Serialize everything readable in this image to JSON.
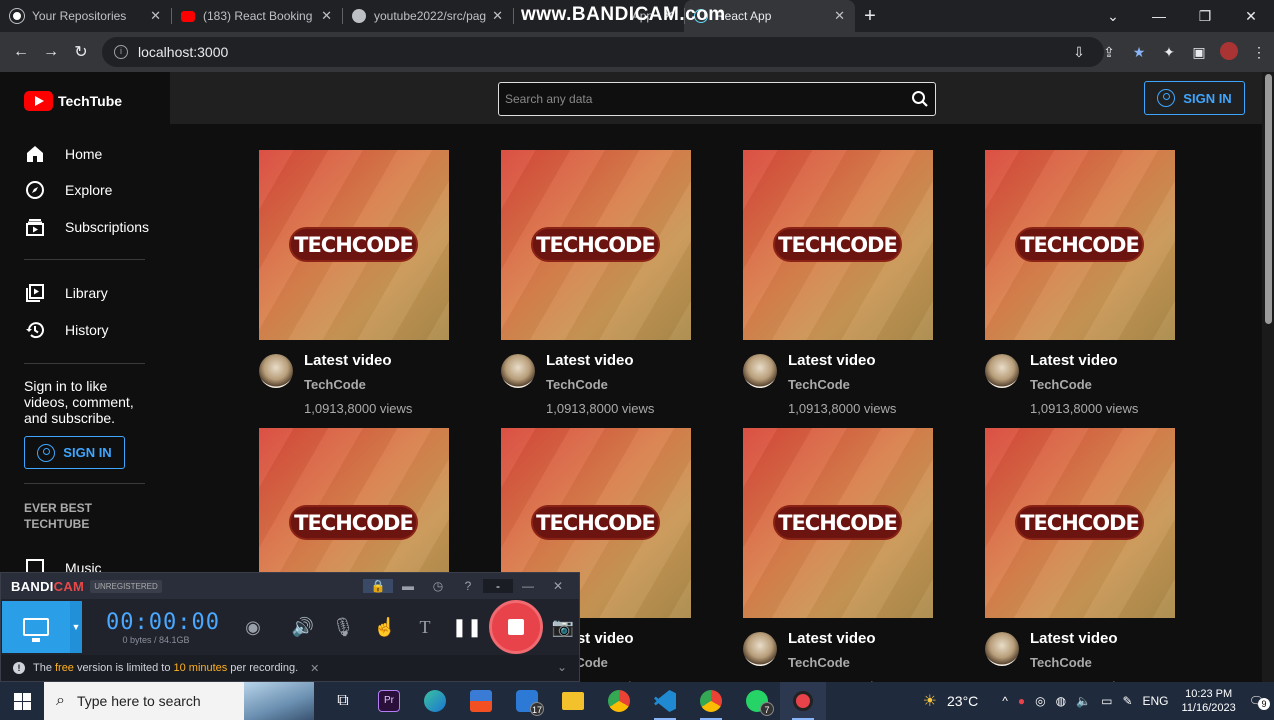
{
  "browser": {
    "tabs": [
      {
        "title": "Your Repositories",
        "favicon": "github-icon",
        "active": false
      },
      {
        "title": "(183) React Booking",
        "favicon": "youtube-icon",
        "active": false
      },
      {
        "title": "youtube2022/src/pag",
        "favicon": "github-icon",
        "active": false
      },
      {
        "title": "App",
        "favicon": "react-icon",
        "active": false
      },
      {
        "title": "React App",
        "favicon": "react-icon",
        "active": true
      }
    ],
    "watermark": "www.BANDICAM.com",
    "address": "localhost:3000"
  },
  "app": {
    "brand": "TechTube",
    "search_placeholder": "Search any data",
    "signin_label": "SIGN IN",
    "nav": [
      {
        "label": "Home",
        "icon": "home-icon"
      },
      {
        "label": "Explore",
        "icon": "compass-icon"
      },
      {
        "label": "Subscriptions",
        "icon": "subscriptions-icon"
      },
      {
        "label": "Library",
        "icon": "library-icon"
      },
      {
        "label": "History",
        "icon": "history-icon"
      },
      {
        "label": "Music",
        "icon": "music-icon"
      }
    ],
    "signin_prompt": "Sign in to like videos, comment, and subscribe.",
    "section_title": "EVER BEST TECHTUBE",
    "video": {
      "thumbnail_text": "TECHCODE",
      "title": "Latest video",
      "channel": "TechCode",
      "views": "1,0913,8000 views"
    }
  },
  "bandicam": {
    "logo": "BANDICAM",
    "registration": "UNREGISTERED",
    "time": "00:00:00",
    "size": "0 bytes / 84.1GB",
    "notice_prefix": "The ",
    "notice_free": "free",
    "notice_mid": " version is limited to ",
    "notice_limit": "10 minutes",
    "notice_suffix": " per recording."
  },
  "taskbar": {
    "search_placeholder": "Type here to search",
    "weather": "23°C",
    "language": "ENG",
    "time": "10:23 PM",
    "date": "11/16/2023",
    "notifications": "9",
    "badges": {
      "mail": "17",
      "whatsapp": "7"
    }
  },
  "colors": {
    "accent": "#3ea6ff",
    "youtube_red": "#ff0000",
    "bandicam_blue": "#2a9fe8",
    "record_red": "#e8424a"
  }
}
